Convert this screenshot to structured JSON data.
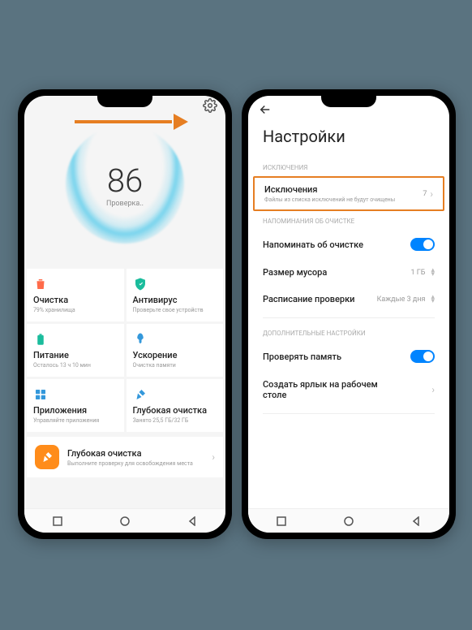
{
  "left": {
    "score": "86",
    "score_label": "Проверка..",
    "cards": [
      {
        "icon": "trash-icon",
        "title": "Очистка",
        "sub": "79% хранилища"
      },
      {
        "icon": "shield-icon",
        "title": "Антивирус",
        "sub": "Проверьте свое устройств"
      },
      {
        "icon": "battery-icon",
        "title": "Питание",
        "sub": "Осталось 13 ч 10 мин"
      },
      {
        "icon": "rocket-icon",
        "title": "Ускорение",
        "sub": "Очистка памяти"
      },
      {
        "icon": "apps-icon",
        "title": "Приложения",
        "sub": "Управляйте приложения"
      },
      {
        "icon": "broom-icon",
        "title": "Глубокая очистка",
        "sub": "Занято 25,5 ГБ/32 ГБ"
      }
    ],
    "banner": {
      "title": "Глубокая очистка",
      "sub": "Выполните проверку для освобождения места"
    }
  },
  "right": {
    "title": "Настройки",
    "sections": {
      "exclusions_label": "ИСКЛЮЧЕНИЯ",
      "exclusions": {
        "title": "Исключения",
        "sub": "Файлы из списка исключений не будут очищены",
        "value": "7"
      },
      "reminders_label": "НАПОМИНАНИЯ ОБ ОЧИСТКЕ",
      "remind": {
        "title": "Напоминать об очистке"
      },
      "trash_size": {
        "title": "Размер мусора",
        "value": "1 ГБ"
      },
      "schedule": {
        "title": "Расписание проверки",
        "value": "Каждые 3 дня"
      },
      "extra_label": "ДОПОЛНИТЕЛЬНЫЕ НАСТРОЙКИ",
      "check_mem": {
        "title": "Проверять память"
      },
      "shortcut": {
        "title": "Создать ярлык на рабочем столе"
      }
    }
  }
}
